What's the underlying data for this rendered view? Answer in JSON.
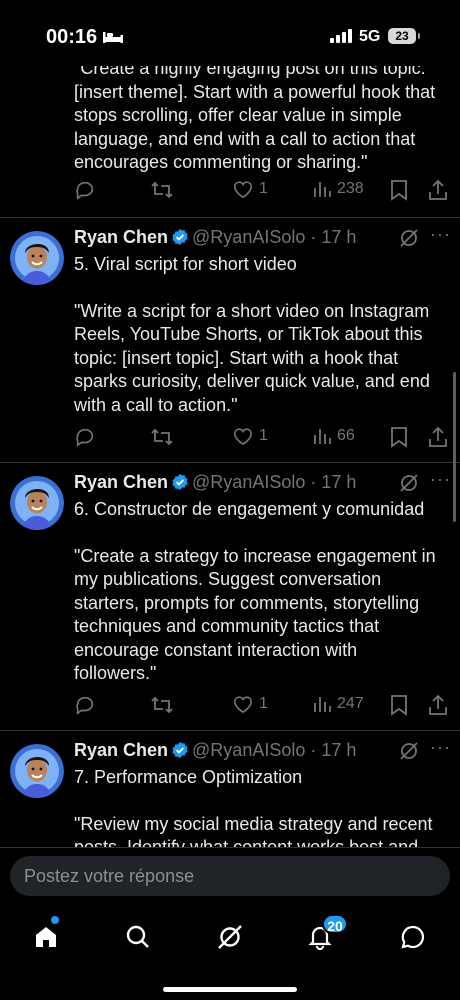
{
  "status_bar": {
    "time": "00:16",
    "network": "5G",
    "battery": "23"
  },
  "top_fragment": {
    "text": "\"Create a highly engaging post on this topic: [insert theme]. Start with a powerful hook that stops scrolling, offer clear value in simple language, and end with a call to action that encourages commenting or sharing.\"",
    "likes": "1",
    "views": "238"
  },
  "tweets": [
    {
      "name": "Ryan Chen",
      "handle": "@RyanAISolo",
      "dot": "·",
      "time": "17 h",
      "title": "5. Viral script for short video",
      "text": "\"Write a script for a short video on Instagram Reels, YouTube Shorts, or TikTok about this topic: [insert topic]. Start with a hook that sparks curiosity, deliver quick value, and end with a call to action.\"",
      "likes": "1",
      "views": "66"
    },
    {
      "name": "Ryan Chen",
      "handle": "@RyanAISolo",
      "dot": "·",
      "time": "17 h",
      "title": "6. Constructor de engagement y comunidad",
      "text": "\"Create a strategy to increase engagement in my publications. Suggest conversation starters, prompts for comments, storytelling techniques and community tactics that encourage constant interaction with followers.\"",
      "likes": "1",
      "views": "247"
    },
    {
      "name": "Ryan Chen",
      "handle": "@RyanAISolo",
      "dot": "·",
      "time": "17 h",
      "title": "7. Performance Optimization",
      "text": "\"Review my social media strategy and recent posts. Identify what content works best and what"
    }
  ],
  "reply": {
    "placeholder": "Postez votre réponse"
  },
  "tab_bar": {
    "notifications_badge": "20"
  },
  "icons": {
    "reply": "reply-icon",
    "retweet": "retweet-icon",
    "like": "heart-icon",
    "views": "views-icon",
    "bookmark": "bookmark-icon",
    "share": "share-icon",
    "verified": "verified-badge-icon",
    "grok": "grok-icon",
    "more": "more-icon",
    "home": "home-icon",
    "search": "search-icon",
    "notifications": "bell-icon",
    "messages": "messages-icon"
  },
  "colors": {
    "accent": "#1d9bf0",
    "muted": "#71767b",
    "text": "#e7e9ea",
    "background": "#000000"
  }
}
